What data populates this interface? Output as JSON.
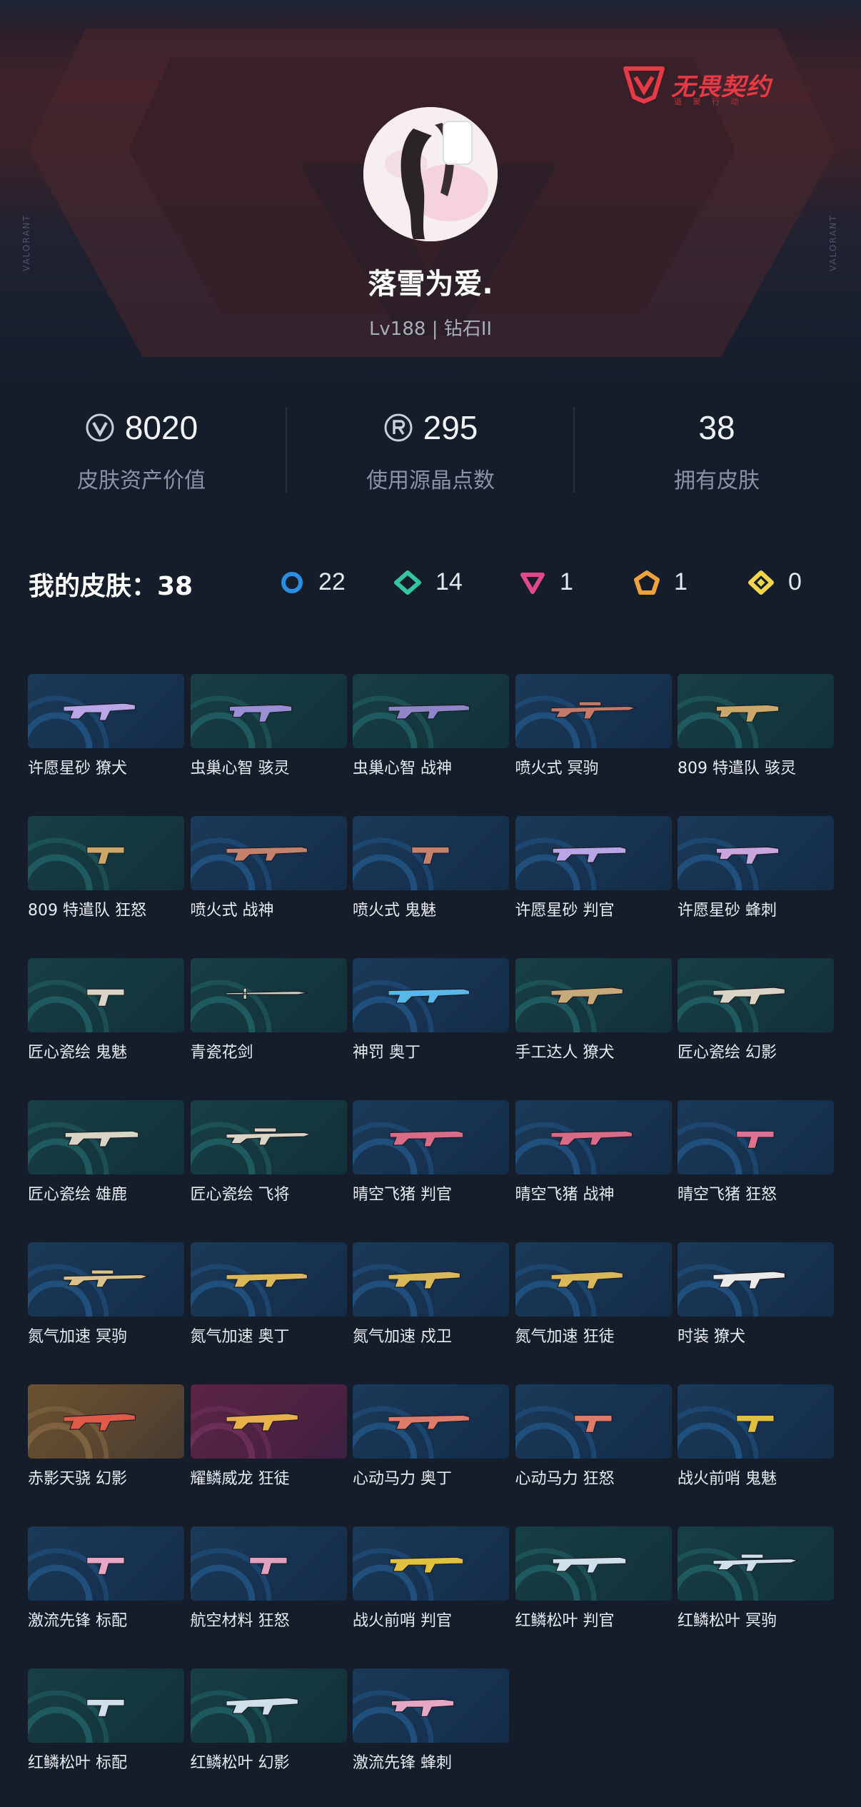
{
  "header": {
    "logo_text": "无畏契约",
    "logo_sub": "道 聚 行 动",
    "side_text_left": "VALORANT",
    "side_text_right": "VALORANT"
  },
  "player": {
    "name": "落雪为爱.",
    "level_rank": "Lv188 | 钻石II"
  },
  "stats": [
    {
      "icon": "valorant-points-icon",
      "value": "8020",
      "label": "皮肤资产价值"
    },
    {
      "icon": "radianite-icon",
      "value": "295",
      "label": "使用源晶点数"
    },
    {
      "icon": "",
      "value": "38",
      "label": "拥有皮肤"
    }
  ],
  "skins_summary": {
    "title": "我的皮肤：38",
    "tiers": [
      {
        "icon": "select-tier-icon",
        "color": "#2a8fe0",
        "count": "22"
      },
      {
        "icon": "deluxe-tier-icon",
        "color": "#33c6a0",
        "count": "14"
      },
      {
        "icon": "premium-tier-icon",
        "color": "#e04a8c",
        "count": "1"
      },
      {
        "icon": "exclusive-tier-icon",
        "color": "#f0a23a",
        "count": "1"
      },
      {
        "icon": "ultra-tier-icon",
        "color": "#f2d54a",
        "count": "0"
      }
    ]
  },
  "skins": [
    {
      "name": "许愿星砂 獠犬",
      "bg": "blue",
      "gun": "rifle",
      "tint": "#b9a6e6"
    },
    {
      "name": "虫巢心智 骇灵",
      "bg": "green",
      "gun": "smg",
      "tint": "#9a8fd6"
    },
    {
      "name": "虫巢心智 战神",
      "bg": "green",
      "gun": "lmg",
      "tint": "#8f86c8"
    },
    {
      "name": "喷火式 冥驹",
      "bg": "blue",
      "gun": "sniper",
      "tint": "#c47a6a"
    },
    {
      "name": "809 特遣队 骇灵",
      "bg": "green",
      "gun": "smg",
      "tint": "#c9a86a"
    },
    {
      "name": "809 特遣队 狂怒",
      "bg": "green",
      "gun": "pistol",
      "tint": "#c9a86a"
    },
    {
      "name": "喷火式 战神",
      "bg": "blue",
      "gun": "lmg",
      "tint": "#c4826e"
    },
    {
      "name": "喷火式 鬼魅",
      "bg": "blue",
      "gun": "pistol",
      "tint": "#c4826e"
    },
    {
      "name": "许愿星砂 判官",
      "bg": "blue",
      "gun": "shotgun",
      "tint": "#b9a6e6"
    },
    {
      "name": "许愿星砂 蜂刺",
      "bg": "blue",
      "gun": "smg",
      "tint": "#c9a6dd"
    },
    {
      "name": "匠心瓷绘 鬼魅",
      "bg": "green",
      "gun": "pistol",
      "tint": "#d9d4c6"
    },
    {
      "name": "青瓷花剑",
      "bg": "green",
      "gun": "sword",
      "tint": "#c9d1c9"
    },
    {
      "name": "神罚 奥丁",
      "bg": "blue",
      "gun": "lmg",
      "tint": "#5ab8e8"
    },
    {
      "name": "手工达人 獠犬",
      "bg": "green",
      "gun": "rifle",
      "tint": "#c7a97a"
    },
    {
      "name": "匠心瓷绘 幻影",
      "bg": "green",
      "gun": "rifle",
      "tint": "#d9d4c6"
    },
    {
      "name": "匠心瓷绘 雄鹿",
      "bg": "green",
      "gun": "shotgun",
      "tint": "#d9d4c6"
    },
    {
      "name": "匠心瓷绘 飞将",
      "bg": "green",
      "gun": "sniper",
      "tint": "#d9d4c6"
    },
    {
      "name": "晴空飞猪 判官",
      "bg": "blue",
      "gun": "shotgun",
      "tint": "#d96a88"
    },
    {
      "name": "晴空飞猪 战神",
      "bg": "blue",
      "gun": "lmg",
      "tint": "#d96a88"
    },
    {
      "name": "晴空飞猪 狂怒",
      "bg": "blue",
      "gun": "pistol",
      "tint": "#e0708e"
    },
    {
      "name": "氮气加速 冥驹",
      "bg": "blue",
      "gun": "sniper",
      "tint": "#d8c48a"
    },
    {
      "name": "氮气加速 奥丁",
      "bg": "blue",
      "gun": "lmg",
      "tint": "#d8b85a"
    },
    {
      "name": "氮气加速 戍卫",
      "bg": "blue",
      "gun": "rifle",
      "tint": "#d8b85a"
    },
    {
      "name": "氮气加速 狂徒",
      "bg": "blue",
      "gun": "rifle",
      "tint": "#d8b85a"
    },
    {
      "name": "时装 獠犬",
      "bg": "blue",
      "gun": "rifle",
      "tint": "#eaeaea"
    },
    {
      "name": "赤影天骁 幻影",
      "bg": "orange",
      "gun": "rifle",
      "tint": "#e05a4a"
    },
    {
      "name": "耀鳞威龙 狂徒",
      "bg": "purple",
      "gun": "rifle",
      "tint": "#e8b04a"
    },
    {
      "name": "心动马力 奥丁",
      "bg": "blue",
      "gun": "lmg",
      "tint": "#e07a6a"
    },
    {
      "name": "心动马力 狂怒",
      "bg": "blue",
      "gun": "pistol",
      "tint": "#e07a6a"
    },
    {
      "name": "战火前哨 鬼魅",
      "bg": "blue",
      "gun": "pistol",
      "tint": "#e0c040"
    },
    {
      "name": "激流先锋 标配",
      "bg": "blue",
      "gun": "pistol",
      "tint": "#e6a6c6"
    },
    {
      "name": "航空材料 狂怒",
      "bg": "blue",
      "gun": "pistol",
      "tint": "#e0a0c0"
    },
    {
      "name": "战火前哨 判官",
      "bg": "blue",
      "gun": "shotgun",
      "tint": "#e0c040"
    },
    {
      "name": "红鳞松叶 判官",
      "bg": "green",
      "gun": "shotgun",
      "tint": "#cfe0ea"
    },
    {
      "name": "红鳞松叶 冥驹",
      "bg": "green",
      "gun": "sniper",
      "tint": "#cfe0ea"
    },
    {
      "name": "红鳞松叶 标配",
      "bg": "green",
      "gun": "pistol",
      "tint": "#cfe0ea"
    },
    {
      "name": "红鳞松叶 幻影",
      "bg": "green",
      "gun": "rifle",
      "tint": "#cfe0ea"
    },
    {
      "name": "激流先锋 蜂刺",
      "bg": "blue",
      "gun": "smg",
      "tint": "#e6a6c6"
    }
  ]
}
